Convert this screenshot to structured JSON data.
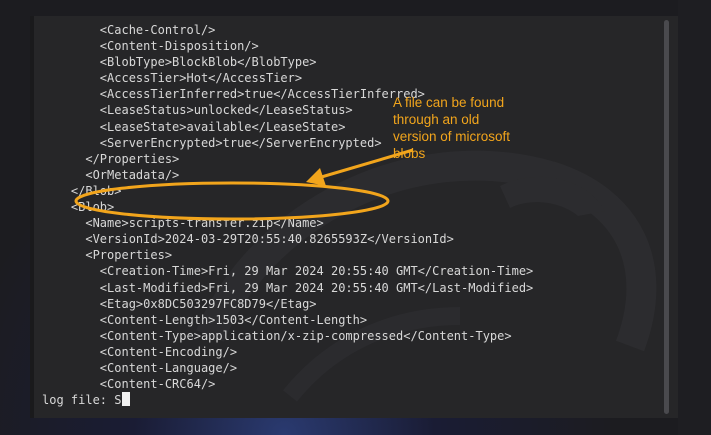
{
  "terminal": {
    "lines": [
      "        <Cache-Control/>",
      "        <Content-Disposition/>",
      "        <BlobType>BlockBlob</BlobType>",
      "        <AccessTier>Hot</AccessTier>",
      "        <AccessTierInferred>true</AccessTierInferred>",
      "        <LeaseStatus>unlocked</LeaseStatus>",
      "        <LeaseState>available</LeaseState>",
      "        <ServerEncrypted>true</ServerEncrypted>",
      "      </Properties>",
      "      <OrMetadata/>",
      "    </Blob>",
      "    <Blob>",
      "      <Name>scripts-transfer.zip</Name>",
      "      <VersionId>2024-03-29T20:55:40.8265593Z</VersionId>",
      "      <Properties>",
      "        <Creation-Time>Fri, 29 Mar 2024 20:55:40 GMT</Creation-Time>",
      "        <Last-Modified>Fri, 29 Mar 2024 20:55:40 GMT</Last-Modified>",
      "        <Etag>0x8DC503297FC8D79</Etag>",
      "        <Content-Length>1503</Content-Length>",
      "        <Content-Type>application/x-zip-compressed</Content-Type>",
      "        <Content-Encoding/>",
      "        <Content-Language/>",
      "        <Content-CRC64/>"
    ],
    "prompt": "log file: S"
  },
  "annotation": {
    "text": "A file can be found\nthrough an old\nversion of microsoft\nblobs",
    "color": "#f2a51c"
  },
  "colors": {
    "terminal_bg": "#262628",
    "text": "#d8d8d8",
    "accent": "#f2a51c"
  }
}
